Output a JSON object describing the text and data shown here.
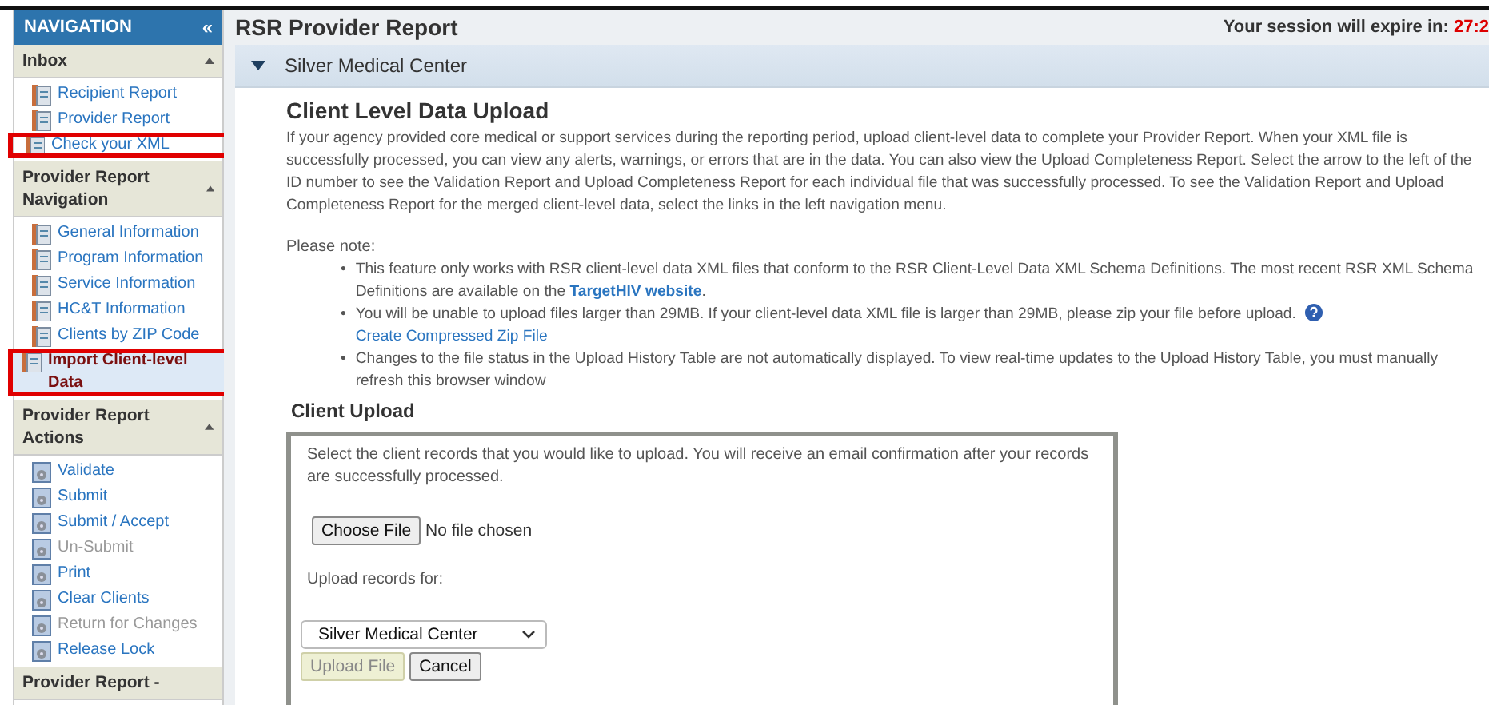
{
  "sidebar": {
    "title": "NAVIGATION",
    "collapse_glyph": "«",
    "sections": [
      {
        "title": "Inbox",
        "expanded": true,
        "items": [
          {
            "label": "Recipient Report",
            "kind": "report",
            "selected": false,
            "disabled": false,
            "highlighted": false
          },
          {
            "label": "Provider Report",
            "kind": "report",
            "selected": false,
            "disabled": false,
            "highlighted": false
          },
          {
            "label": "Check your XML",
            "kind": "report",
            "selected": false,
            "disabled": false,
            "highlighted": true
          }
        ]
      },
      {
        "title": "Provider Report Navigation",
        "expanded": true,
        "items": [
          {
            "label": "General Information",
            "kind": "report",
            "selected": false,
            "disabled": false,
            "highlighted": false
          },
          {
            "label": "Program Information",
            "kind": "report",
            "selected": false,
            "disabled": false,
            "highlighted": false
          },
          {
            "label": "Service Information",
            "kind": "report",
            "selected": false,
            "disabled": false,
            "highlighted": false
          },
          {
            "label": "HC&T Information",
            "kind": "report",
            "selected": false,
            "disabled": false,
            "highlighted": false
          },
          {
            "label": "Clients by ZIP Code",
            "kind": "report",
            "selected": false,
            "disabled": false,
            "highlighted": false
          },
          {
            "label": "Import Client-level Data",
            "kind": "report",
            "selected": true,
            "disabled": false,
            "highlighted": true
          }
        ]
      },
      {
        "title": "Provider Report Actions",
        "expanded": true,
        "items": [
          {
            "label": "Validate",
            "kind": "action",
            "selected": false,
            "disabled": false,
            "highlighted": false
          },
          {
            "label": "Submit",
            "kind": "action",
            "selected": false,
            "disabled": false,
            "highlighted": false
          },
          {
            "label": "Submit / Accept",
            "kind": "action",
            "selected": false,
            "disabled": false,
            "highlighted": false
          },
          {
            "label": "Un-Submit",
            "kind": "action",
            "selected": false,
            "disabled": true,
            "highlighted": false
          },
          {
            "label": "Print",
            "kind": "action",
            "selected": false,
            "disabled": false,
            "highlighted": false
          },
          {
            "label": "Clear Clients",
            "kind": "action",
            "selected": false,
            "disabled": false,
            "highlighted": false
          },
          {
            "label": "Return for Changes",
            "kind": "action",
            "selected": false,
            "disabled": true,
            "highlighted": false
          },
          {
            "label": "Release Lock",
            "kind": "action",
            "selected": false,
            "disabled": false,
            "highlighted": false
          }
        ]
      },
      {
        "title": "Provider Report -"
      }
    ]
  },
  "header": {
    "title": "RSR Provider Report",
    "session_label": "Your session will expire in:",
    "session_time": "27:2"
  },
  "panel": {
    "title": "Silver Medical Center",
    "expanded": true
  },
  "upload": {
    "heading": "Client Level Data Upload",
    "intro": "If your agency provided core medical or support services during the reporting period, upload client-level data to complete your Provider Report. When your XML file is successfully processed, you can view any alerts, warnings, or errors that are in the data. You can also view the Upload Completeness Report. Select the arrow to the left of the ID number to see the Validation Report and Upload Completeness Report for each individual file that was successfully processed. To see the Validation Report and Upload Completeness Report for the merged client-level data, select the links in the left navigation menu.",
    "note_label": "Please note:",
    "bullet": "•",
    "notes": [
      {
        "text": "This feature only works with RSR client-level data XML files that conform to the RSR Client-Level Data XML Schema Definitions. The most recent RSR XML Schema Definitions are available on the ",
        "link": "TargetHIV website",
        "after": "."
      },
      {
        "text": "You will be unable to upload files larger than 29MB. If your client-level data XML file is larger than 29MB, please zip your file before upload.",
        "help_link": "Create Compressed Zip File"
      },
      {
        "text": "Changes to the file status in the Upload History Table are not automatically displayed. To view real-time updates to the Upload History Table, you must manually refresh this browser window"
      }
    ]
  },
  "client_upload": {
    "heading": "Client Upload",
    "instructions": "Select the client records that you would like to upload. You will receive an email confirmation after your records are successfully processed.",
    "choose_button": "Choose File",
    "file_status": "No file chosen",
    "records_label": "Upload records for:",
    "records_value": "Silver Medical Center",
    "upload_button": {
      "label": "Upload File",
      "disabled": true
    },
    "cancel_button": "Cancel"
  }
}
